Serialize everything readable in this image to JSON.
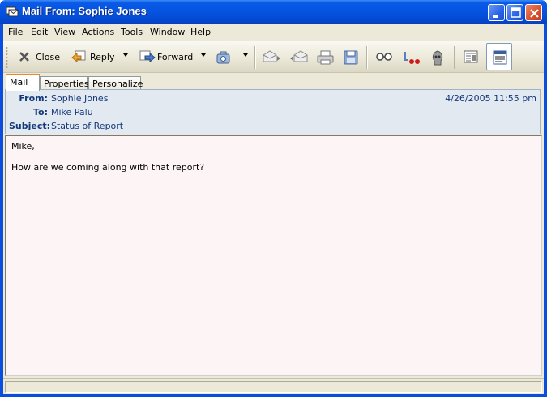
{
  "window": {
    "title": "Mail From: Sophie Jones"
  },
  "menu": [
    "File",
    "Edit",
    "View",
    "Actions",
    "Tools",
    "Window",
    "Help"
  ],
  "toolbar": {
    "close_label": "Close",
    "reply_label": "Reply",
    "forward_label": "Forward"
  },
  "tabs": [
    "Mail",
    "Properties",
    "Personalize"
  ],
  "header": {
    "from_label": "From:",
    "from_value": "Sophie Jones",
    "to_label": "To:",
    "to_value": "Mike Palu",
    "subject_label": "Subject:",
    "subject_value": "Status of Report",
    "date": "4/26/2005 11:55 pm"
  },
  "message": {
    "lines": [
      "Mike,",
      "How are we coming along with that report?"
    ]
  },
  "colors": {
    "titlebar": "#0553e0",
    "header_bg": "#e2e9f1",
    "body_bg": "#fdf5f5"
  }
}
